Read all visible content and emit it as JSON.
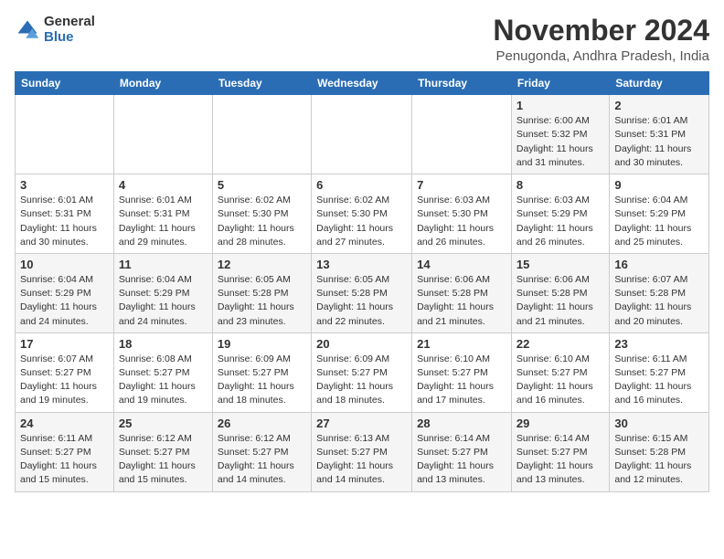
{
  "header": {
    "logo_general": "General",
    "logo_blue": "Blue",
    "month_title": "November 2024",
    "location": "Penugonda, Andhra Pradesh, India"
  },
  "weekdays": [
    "Sunday",
    "Monday",
    "Tuesday",
    "Wednesday",
    "Thursday",
    "Friday",
    "Saturday"
  ],
  "weeks": [
    [
      {
        "day": "",
        "info": ""
      },
      {
        "day": "",
        "info": ""
      },
      {
        "day": "",
        "info": ""
      },
      {
        "day": "",
        "info": ""
      },
      {
        "day": "",
        "info": ""
      },
      {
        "day": "1",
        "info": "Sunrise: 6:00 AM\nSunset: 5:32 PM\nDaylight: 11 hours and 31 minutes."
      },
      {
        "day": "2",
        "info": "Sunrise: 6:01 AM\nSunset: 5:31 PM\nDaylight: 11 hours and 30 minutes."
      }
    ],
    [
      {
        "day": "3",
        "info": "Sunrise: 6:01 AM\nSunset: 5:31 PM\nDaylight: 11 hours and 30 minutes."
      },
      {
        "day": "4",
        "info": "Sunrise: 6:01 AM\nSunset: 5:31 PM\nDaylight: 11 hours and 29 minutes."
      },
      {
        "day": "5",
        "info": "Sunrise: 6:02 AM\nSunset: 5:30 PM\nDaylight: 11 hours and 28 minutes."
      },
      {
        "day": "6",
        "info": "Sunrise: 6:02 AM\nSunset: 5:30 PM\nDaylight: 11 hours and 27 minutes."
      },
      {
        "day": "7",
        "info": "Sunrise: 6:03 AM\nSunset: 5:30 PM\nDaylight: 11 hours and 26 minutes."
      },
      {
        "day": "8",
        "info": "Sunrise: 6:03 AM\nSunset: 5:29 PM\nDaylight: 11 hours and 26 minutes."
      },
      {
        "day": "9",
        "info": "Sunrise: 6:04 AM\nSunset: 5:29 PM\nDaylight: 11 hours and 25 minutes."
      }
    ],
    [
      {
        "day": "10",
        "info": "Sunrise: 6:04 AM\nSunset: 5:29 PM\nDaylight: 11 hours and 24 minutes."
      },
      {
        "day": "11",
        "info": "Sunrise: 6:04 AM\nSunset: 5:29 PM\nDaylight: 11 hours and 24 minutes."
      },
      {
        "day": "12",
        "info": "Sunrise: 6:05 AM\nSunset: 5:28 PM\nDaylight: 11 hours and 23 minutes."
      },
      {
        "day": "13",
        "info": "Sunrise: 6:05 AM\nSunset: 5:28 PM\nDaylight: 11 hours and 22 minutes."
      },
      {
        "day": "14",
        "info": "Sunrise: 6:06 AM\nSunset: 5:28 PM\nDaylight: 11 hours and 21 minutes."
      },
      {
        "day": "15",
        "info": "Sunrise: 6:06 AM\nSunset: 5:28 PM\nDaylight: 11 hours and 21 minutes."
      },
      {
        "day": "16",
        "info": "Sunrise: 6:07 AM\nSunset: 5:28 PM\nDaylight: 11 hours and 20 minutes."
      }
    ],
    [
      {
        "day": "17",
        "info": "Sunrise: 6:07 AM\nSunset: 5:27 PM\nDaylight: 11 hours and 19 minutes."
      },
      {
        "day": "18",
        "info": "Sunrise: 6:08 AM\nSunset: 5:27 PM\nDaylight: 11 hours and 19 minutes."
      },
      {
        "day": "19",
        "info": "Sunrise: 6:09 AM\nSunset: 5:27 PM\nDaylight: 11 hours and 18 minutes."
      },
      {
        "day": "20",
        "info": "Sunrise: 6:09 AM\nSunset: 5:27 PM\nDaylight: 11 hours and 18 minutes."
      },
      {
        "day": "21",
        "info": "Sunrise: 6:10 AM\nSunset: 5:27 PM\nDaylight: 11 hours and 17 minutes."
      },
      {
        "day": "22",
        "info": "Sunrise: 6:10 AM\nSunset: 5:27 PM\nDaylight: 11 hours and 16 minutes."
      },
      {
        "day": "23",
        "info": "Sunrise: 6:11 AM\nSunset: 5:27 PM\nDaylight: 11 hours and 16 minutes."
      }
    ],
    [
      {
        "day": "24",
        "info": "Sunrise: 6:11 AM\nSunset: 5:27 PM\nDaylight: 11 hours and 15 minutes."
      },
      {
        "day": "25",
        "info": "Sunrise: 6:12 AM\nSunset: 5:27 PM\nDaylight: 11 hours and 15 minutes."
      },
      {
        "day": "26",
        "info": "Sunrise: 6:12 AM\nSunset: 5:27 PM\nDaylight: 11 hours and 14 minutes."
      },
      {
        "day": "27",
        "info": "Sunrise: 6:13 AM\nSunset: 5:27 PM\nDaylight: 11 hours and 14 minutes."
      },
      {
        "day": "28",
        "info": "Sunrise: 6:14 AM\nSunset: 5:27 PM\nDaylight: 11 hours and 13 minutes."
      },
      {
        "day": "29",
        "info": "Sunrise: 6:14 AM\nSunset: 5:27 PM\nDaylight: 11 hours and 13 minutes."
      },
      {
        "day": "30",
        "info": "Sunrise: 6:15 AM\nSunset: 5:28 PM\nDaylight: 11 hours and 12 minutes."
      }
    ]
  ]
}
